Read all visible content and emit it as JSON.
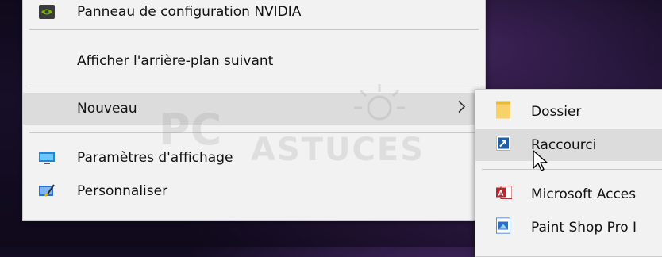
{
  "context_menu": {
    "items": [
      {
        "label": "Panneau de configuration NVIDIA",
        "icon": "nvidia-icon"
      },
      {
        "label": "Afficher l'arrière-plan suivant",
        "icon": null
      },
      {
        "label": "Nouveau",
        "icon": null,
        "has_submenu": true
      },
      {
        "label": "Paramètres d'affichage",
        "icon": "display-settings-icon"
      },
      {
        "label": "Personnaliser",
        "icon": "personalize-icon"
      }
    ]
  },
  "submenu": {
    "items": [
      {
        "label": "Dossier",
        "icon": "folder-icon"
      },
      {
        "label": "Raccourci",
        "icon": "shortcut-icon"
      },
      {
        "label": "Microsoft Acces",
        "icon": "access-icon"
      },
      {
        "label": "Paint Shop Pro I",
        "icon": "paintshop-icon"
      }
    ]
  },
  "watermark": {
    "line1": "PC",
    "line2": "ASTUCES"
  },
  "colors": {
    "menu_bg": "#f2f2f2",
    "hover_bg": "#dcdcdc",
    "nvidia_green": "#76b900"
  }
}
